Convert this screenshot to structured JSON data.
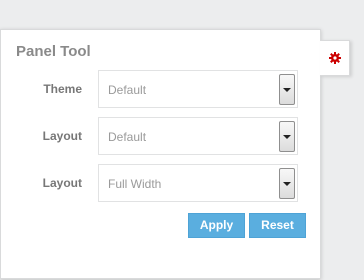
{
  "panel": {
    "title": "Panel Tool",
    "toggle_icon": "gear-icon",
    "toggle_icon_color": "#cc0000"
  },
  "fields": [
    {
      "label": "Theme",
      "value": "Default"
    },
    {
      "label": "Layout",
      "value": "Default"
    },
    {
      "label": "Layout",
      "value": "Full Width"
    }
  ],
  "buttons": {
    "apply_label": "Apply",
    "reset_label": "Reset",
    "accent_color": "#5aaedf"
  }
}
